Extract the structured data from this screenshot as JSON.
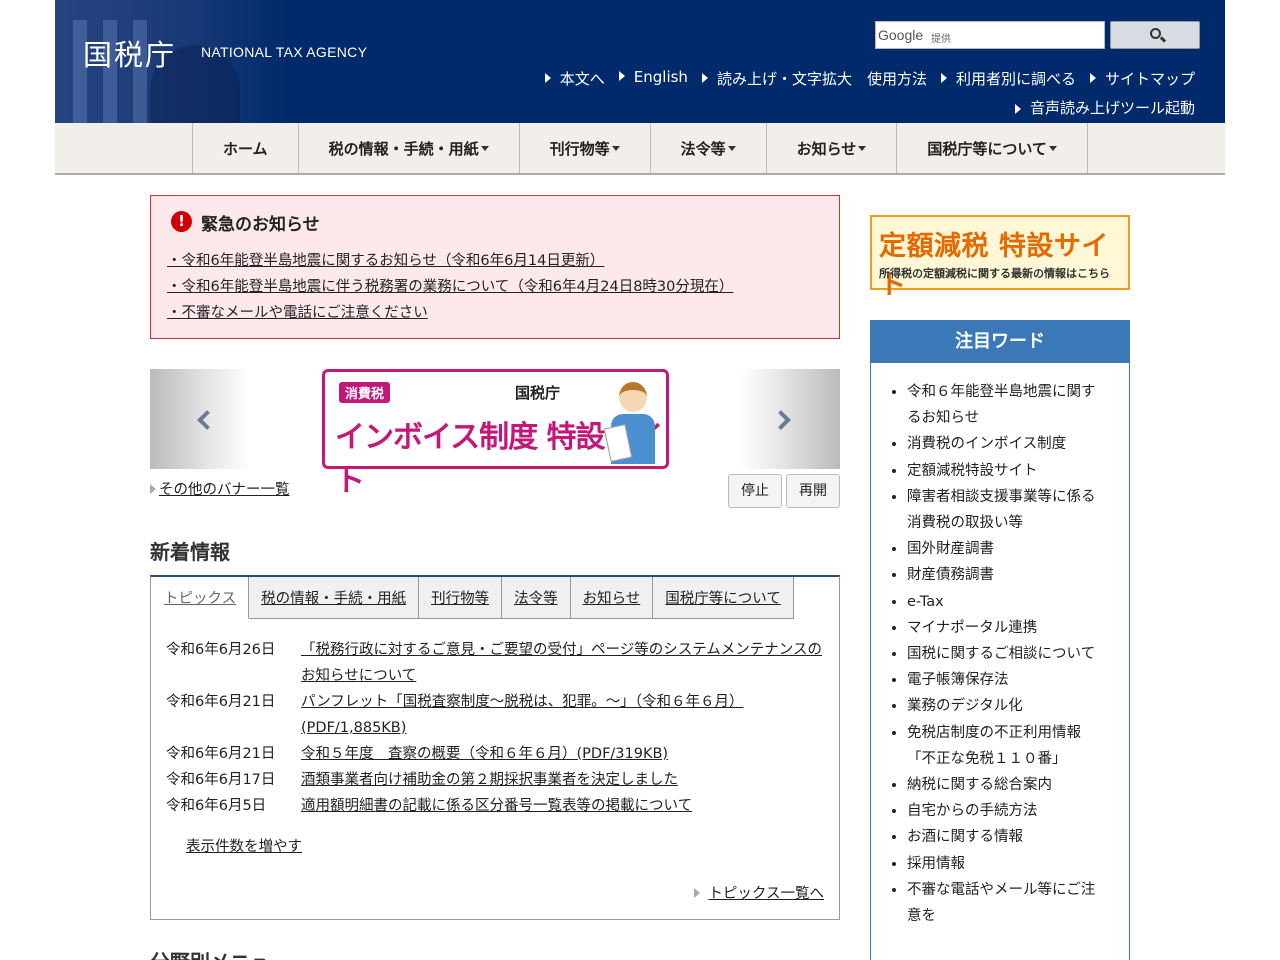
{
  "header": {
    "logo_jp": "国税庁",
    "logo_en": "NATIONAL TAX AGENCY",
    "search": {
      "placeholder": "",
      "google_label": "Google",
      "provided_label": "提供"
    },
    "util_links": [
      "本文へ",
      "English",
      "読み上げ・文字拡大　使用方法",
      "利用者別に調べる",
      "サイトマップ"
    ],
    "tool_link": "音声読み上げツール起動"
  },
  "gnav": [
    "ホーム",
    "税の情報・手続・用紙",
    "刊行物等",
    "法令等",
    "お知らせ",
    "国税庁等について"
  ],
  "emergency": {
    "title": "緊急のお知らせ",
    "items": [
      "・令和6年能登半島地震に関するお知らせ（令和6年6月14日更新）",
      "・令和6年能登半島地震に伴う税務署の業務について（令和6年4月24日8時30分現在）",
      "・不審なメールや電話にご注意ください"
    ]
  },
  "banner": {
    "tag": "消費税",
    "agency": "国税庁",
    "main": "インボイス制度 特設サイト",
    "other_link": "その他のバナー一覧",
    "stop": "停止",
    "resume": "再開"
  },
  "news": {
    "heading": "新着情報",
    "tabs": [
      "トピックス",
      "税の情報・手続・用紙",
      "刊行物等",
      "法令等",
      "お知らせ",
      "国税庁等について"
    ],
    "items": [
      {
        "date": "令和6年6月26日",
        "title": "「税務行政に対するご意見・ご要望の受付」ページ等のシステムメンテナンスのお知らせについて"
      },
      {
        "date": "令和6年6月21日",
        "title": "パンフレット「国税査察制度～脱税は、犯罪。～」（令和６年６月）(PDF/1,885KB)"
      },
      {
        "date": "令和6年6月21日",
        "title": "令和５年度　査察の概要（令和６年６月）(PDF/319KB)"
      },
      {
        "date": "令和6年6月17日",
        "title": "酒類事業者向け補助金の第２期採択事業者を決定しました"
      },
      {
        "date": "令和6年6月5日",
        "title": "適用額明細書の記載に係る区分番号一覧表等の掲載について"
      }
    ],
    "more": "表示件数を増やす",
    "topics_link": "トピックス一覧へ"
  },
  "section_heading": "分野別メニュー",
  "sidebar": {
    "teigaku_main": "定額減税 特設サイト",
    "teigaku_sub": "所得税の定額減税に関する最新の情報はこちら",
    "keywords_title": "注目ワード",
    "keywords": [
      "令和６年能登半島地震に関するお知らせ",
      "消費税のインボイス制度",
      "定額減税特設サイト",
      "障害者相談支援事業等に係る消費税の取扱い等",
      "国外財産調書",
      "財産債務調書",
      "e-Tax",
      "マイナポータル連携",
      "国税に関するご相談について",
      "電子帳簿保存法",
      "業務のデジタル化",
      "免税店制度の不正利用情報「不正な免税１１０番」",
      "納税に関する総合案内",
      "自宅からの手続方法",
      "お酒に関する情報",
      "採用情報",
      "不審な電話やメール等にご注意を"
    ]
  }
}
